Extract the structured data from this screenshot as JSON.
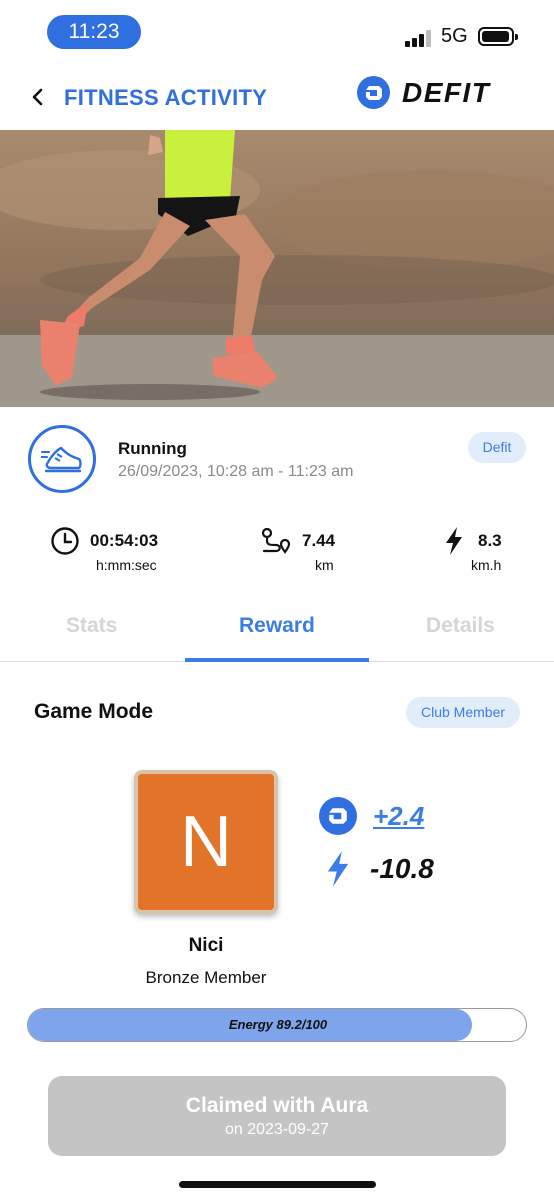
{
  "status_bar": {
    "time": "11:23",
    "network": "5G"
  },
  "header": {
    "title": "FITNESS ACTIVITY",
    "brand": "DEFIT"
  },
  "activity": {
    "type": "Running",
    "datetime": "26/09/2023, 10:28 am - 11:23 am",
    "source": "Defit",
    "stats": [
      {
        "value": "00:54:03",
        "unit": "h:mm:sec",
        "icon": "clock-icon"
      },
      {
        "value": "7.44",
        "unit": "km",
        "icon": "route-icon"
      },
      {
        "value": "8.3",
        "unit": "km.h",
        "icon": "lightning-icon"
      }
    ]
  },
  "tabs": [
    {
      "label": "Stats",
      "active": false
    },
    {
      "label": "Reward",
      "active": true
    },
    {
      "label": "Details",
      "active": false
    }
  ],
  "game_mode": {
    "title": "Game Mode",
    "membership_badge": "Club Member",
    "avatar_letter": "N",
    "user_name": "Nici",
    "user_tier": "Bronze Member",
    "token_reward": "+2.4",
    "energy_change": "-10.8",
    "energy": {
      "label": "Energy 89.2/100",
      "fraction": 0.892
    }
  },
  "claim": {
    "title": "Claimed with Aura",
    "subtitle": "on 2023-09-27"
  },
  "colors": {
    "accent": "#2f6fe0",
    "link": "#3b7de5",
    "avatar": "#e2742a",
    "energy_fill": "#7ea4ec",
    "disabled": "#c4c4c4"
  }
}
